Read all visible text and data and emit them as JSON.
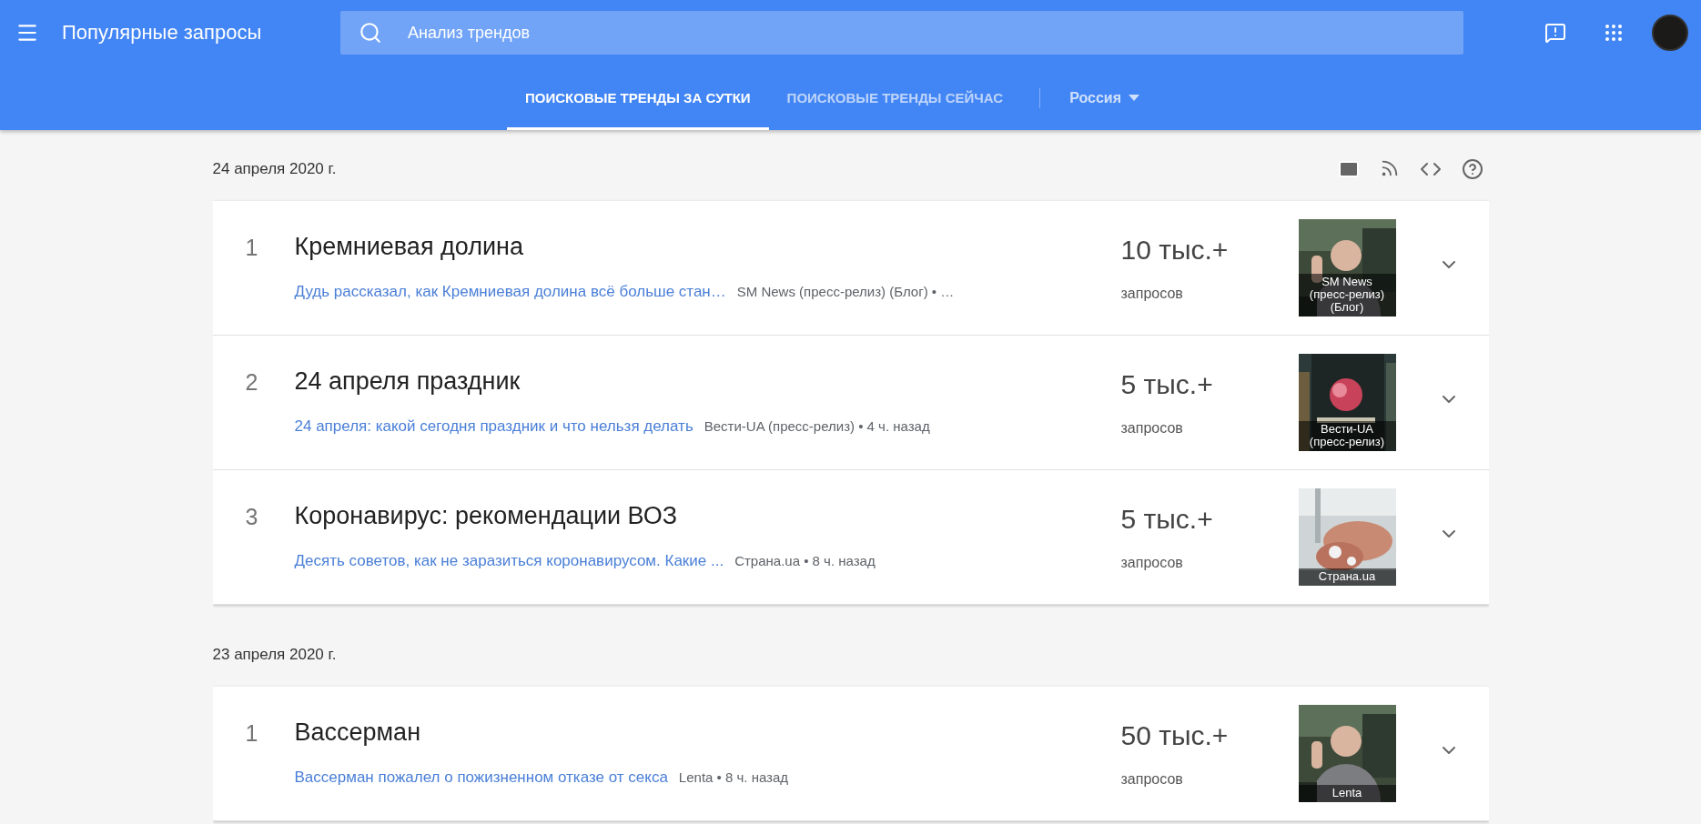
{
  "app_bar": {
    "title": "Популярные запросы",
    "search": {
      "value": "Анализ трендов"
    }
  },
  "tabs": [
    {
      "label": "ПОИСКОВЫЕ ТРЕНДЫ ЗА СУТКИ",
      "selected": true
    },
    {
      "label": "ПОИСКОВЫЕ ТРЕНДЫ СЕЙЧАС",
      "selected": false
    }
  ],
  "region": {
    "label": "Россия"
  },
  "days": [
    {
      "date": "24 апреля 2020 г.",
      "show_tools": true,
      "trends": [
        {
          "rank": "1",
          "title": "Кремниевая долина",
          "article": "Дудь рассказал, как Кремниевая долина всё больше стан…",
          "meta": "SM News (пресс-релиз) (Блог) • …",
          "count": "10 тыс.+",
          "count_label": "запросов",
          "thumb_caption": "SM News (пресс-релиз) (Блог)"
        },
        {
          "rank": "2",
          "title": "24 апреля праздник",
          "article": "24 апреля: какой сегодня праздник и что нельзя делать",
          "meta": "Вести-UA (пресс-релиз) • 4 ч. назад",
          "count": "5 тыс.+",
          "count_label": "запросов",
          "thumb_caption": "Вести-UA (пресс-релиз)"
        },
        {
          "rank": "3",
          "title": "Коронавирус: рекомендации ВОЗ",
          "article": "Десять советов, как не заразиться коронавирусом. Какие ...",
          "meta": "Страна.ua • 8 ч. назад",
          "count": "5 тыс.+",
          "count_label": "запросов",
          "thumb_caption": "Страна.ua"
        }
      ]
    },
    {
      "date": "23 апреля 2020 г.",
      "show_tools": false,
      "trends": [
        {
          "rank": "1",
          "title": "Вассерман",
          "article": "Вассерман пожалел о пожизненном отказе от секса",
          "meta": "Lenta • 8 ч. назад",
          "count": "50 тыс.+",
          "count_label": "запросов",
          "thumb_caption": "Lenta"
        }
      ]
    }
  ]
}
